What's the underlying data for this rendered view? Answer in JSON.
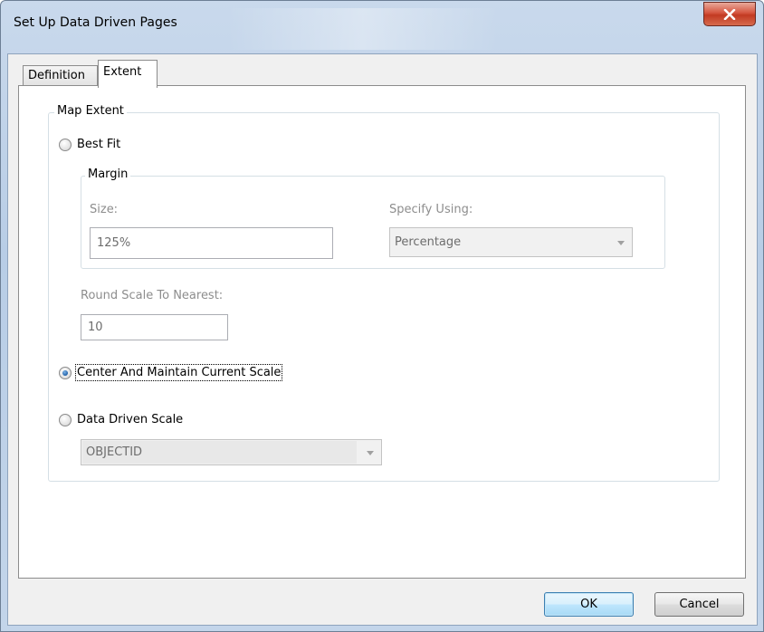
{
  "window": {
    "title": "Set Up Data Driven Pages"
  },
  "tabs": [
    {
      "label": "Definition",
      "active": false
    },
    {
      "label": "Extent",
      "active": true
    }
  ],
  "map_extent": {
    "legend": "Map Extent",
    "best_fit": {
      "label": "Best Fit",
      "checked": false,
      "margin": {
        "legend": "Margin",
        "size_label": "Size:",
        "size_value": "125%",
        "specify_using_label": "Specify Using:",
        "specify_using_value": "Percentage"
      },
      "round_scale_label": "Round Scale To Nearest:",
      "round_scale_value": "10"
    },
    "center_maintain": {
      "label": "Center And Maintain Current Scale",
      "checked": true
    },
    "data_driven_scale": {
      "label": "Data Driven Scale",
      "checked": false,
      "field_value": "OBJECTID"
    }
  },
  "buttons": {
    "ok": "OK",
    "cancel": "Cancel"
  },
  "colors": {
    "accent": "#1d5fa8",
    "close_button": "#c23a22",
    "title_bar": "#b8cde6",
    "disabled_text": "#8d8d8d"
  }
}
